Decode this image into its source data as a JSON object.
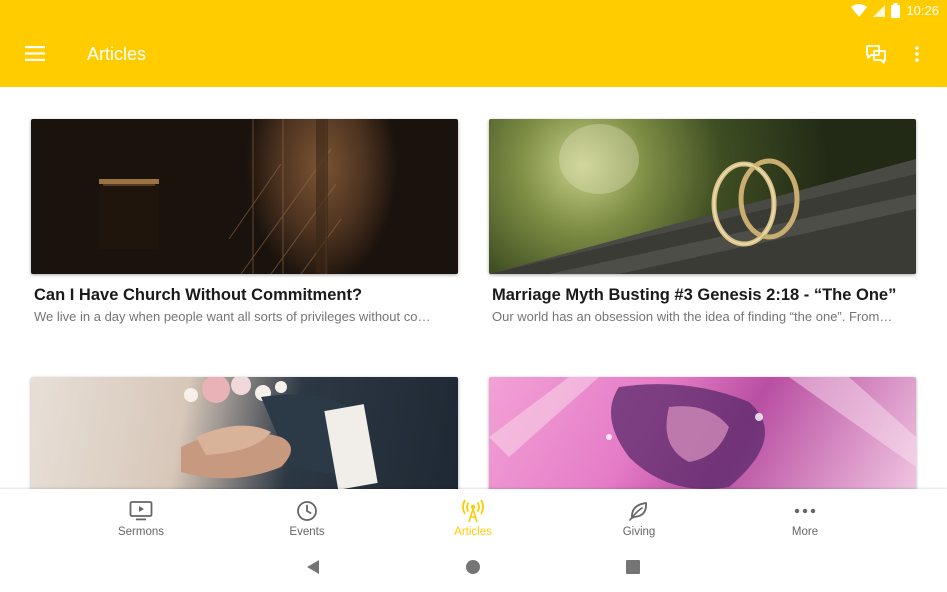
{
  "status_bar": {
    "time": "10:26"
  },
  "app_bar": {
    "title": "Articles"
  },
  "articles": [
    {
      "title": "Can I Have Church Without Commitment?",
      "summary": "We live in a day when people want all sorts of privileges without co…"
    },
    {
      "title": "Marriage Myth Busting #3 Genesis 2:18 - “The One”",
      "summary": "Our world has an obsession with the idea of finding “the one”. From…"
    },
    {
      "title": "",
      "summary": ""
    },
    {
      "title": "",
      "summary": ""
    }
  ],
  "bottom_nav": {
    "items": [
      {
        "label": "Sermons",
        "icon": "tv-play-icon"
      },
      {
        "label": "Events",
        "icon": "clock-icon"
      },
      {
        "label": "Articles",
        "icon": "broadcast-icon",
        "active": true
      },
      {
        "label": "Giving",
        "icon": "leaf-icon"
      },
      {
        "label": "More",
        "icon": "more-horizontal-icon"
      }
    ]
  },
  "colors": {
    "accent": "#ffcc00",
    "text_primary": "#1a1a1a",
    "text_secondary": "#757575",
    "nav_inactive": "#666666"
  }
}
